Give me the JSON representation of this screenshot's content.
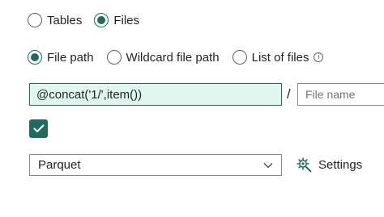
{
  "source_type": {
    "options": [
      {
        "label": "Tables",
        "selected": false
      },
      {
        "label": "Files",
        "selected": true
      }
    ]
  },
  "path_type": {
    "options": [
      {
        "label": "File path",
        "selected": true
      },
      {
        "label": "Wildcard file path",
        "selected": false
      },
      {
        "label": "List of files",
        "selected": false
      }
    ],
    "info_icon": "info-icon"
  },
  "file_path": {
    "value": "@concat('1/',item())",
    "separator": "/",
    "file_name_placeholder": "File name"
  },
  "checkbox": {
    "checked": true
  },
  "format": {
    "selected": "Parquet"
  },
  "settings": {
    "label": "Settings",
    "icon": "settings-gear-icon"
  },
  "colors": {
    "accent": "#1f6b60",
    "input_fill": "#dff6ee"
  }
}
